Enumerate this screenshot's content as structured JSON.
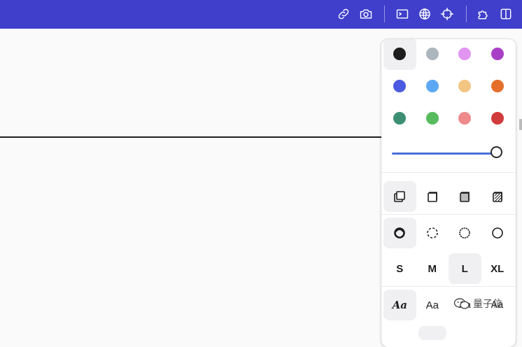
{
  "toolbar": {
    "background_color": "#3f3fcb",
    "icons": [
      "link-icon",
      "camera-icon",
      "terminal-icon",
      "globe-icon",
      "crosshair-icon",
      "puzzle-icon",
      "sidebar-toggle-icon"
    ]
  },
  "style_panel": {
    "colors": [
      {
        "name": "black",
        "hex": "#1d1d1d",
        "selected": true
      },
      {
        "name": "grey",
        "hex": "#adb5bd",
        "selected": false
      },
      {
        "name": "light-violet",
        "hex": "#e195f0",
        "selected": false
      },
      {
        "name": "violet",
        "hex": "#a93fc7",
        "selected": false
      },
      {
        "name": "blue",
        "hex": "#4b5ae0",
        "selected": false
      },
      {
        "name": "light-blue",
        "hex": "#5ca8f5",
        "selected": false
      },
      {
        "name": "yellow",
        "hex": "#f3c583",
        "selected": false
      },
      {
        "name": "orange",
        "hex": "#e56f2a",
        "selected": false
      },
      {
        "name": "green",
        "hex": "#3d8f73",
        "selected": false
      },
      {
        "name": "light-green",
        "hex": "#58bb5e",
        "selected": false
      },
      {
        "name": "light-red",
        "hex": "#ee8a8a",
        "selected": false
      },
      {
        "name": "red",
        "hex": "#d03b3b",
        "selected": false
      }
    ],
    "opacity_value": 1.0,
    "fill_styles": [
      "fill-none",
      "fill-semi",
      "fill-solid",
      "fill-pattern"
    ],
    "fill_selected": 0,
    "dash_styles": [
      "dash-draw",
      "dash-dashed",
      "dash-dotted",
      "dash-solid"
    ],
    "dash_selected": 0,
    "sizes": [
      "S",
      "M",
      "L",
      "XL"
    ],
    "size_selected": 2,
    "fonts": [
      "Aa",
      "Aa",
      "Aa",
      "Aa"
    ],
    "font_selected": 0
  },
  "watermark": {
    "text": "量子位",
    "icon": "wechat-icon"
  }
}
